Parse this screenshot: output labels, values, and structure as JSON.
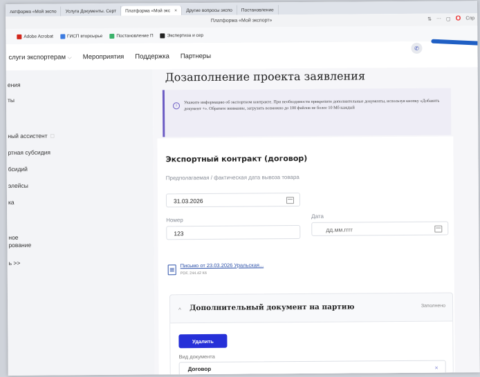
{
  "browser": {
    "tabs": [
      {
        "label": "латформа «Мой экспо"
      },
      {
        "label": "Услуга Документы. Серт"
      },
      {
        "label": "Платформа «Мой экс"
      },
      {
        "label": "Другие вопросы экспо"
      },
      {
        "label": "Постановление"
      }
    ],
    "title": "Платформа «Мой экспорт»",
    "right_text": "Спр",
    "bookmarks": [
      {
        "label": "Adobe Acrobat",
        "color": "#d2271c"
      },
      {
        "label": "ГИСП вторсырье",
        "color": "#3c7be0"
      },
      {
        "label": "Постановление П",
        "color": "#3bb26b"
      },
      {
        "label": "Экспертиза и сер",
        "color": "#222222"
      }
    ]
  },
  "site_nav": {
    "items": [
      {
        "label": "слуги экспортерам"
      },
      {
        "label": "Мероприятия"
      },
      {
        "label": "Поддержка"
      },
      {
        "label": "Партнеры"
      }
    ]
  },
  "sidebar": {
    "items": [
      {
        "label": "ения"
      },
      {
        "label": "ты"
      },
      {
        "label": "ный ассистент"
      },
      {
        "label": "ртная субсидия"
      },
      {
        "label": "бсидий"
      },
      {
        "label": "элейсы"
      },
      {
        "label": "ка"
      },
      {
        "label": "ное"
      },
      {
        "label": "рование"
      },
      {
        "label": "ь >>"
      }
    ]
  },
  "main": {
    "page_title": "Дозаполнение проекта заявления",
    "info_text": "Укажите информацию об экспортном контракте. При необходимости прикрепите дополнительные документы, используя кнопку «Добавить документ +». Обратите внимание, загрузить возможно до 100 файлов не более 10 Мб каждый",
    "section_title": "Экспортный контракт (договор)",
    "export_date": {
      "label": "Предполагаемая / фактическая дата вывоза товара",
      "value": "31.03.2026"
    },
    "number": {
      "label": "Номер",
      "value": "123"
    },
    "date": {
      "label": "Дата",
      "placeholder": "дд.мм.гггг"
    },
    "file": {
      "name": "Письмо от 23.03.2026 Уральская...",
      "meta": "PDF, 244.42 Кб"
    },
    "accordion": {
      "title": "Дополнительный документ на партию",
      "status": "Заполнено",
      "delete_label": "Удалить",
      "doc_type_label": "Вид документа",
      "doc_type_value": "Договор"
    }
  },
  "colors": {
    "accent": "#2630d8",
    "info_border": "#6c5cc4",
    "link": "#2a4fa8"
  }
}
